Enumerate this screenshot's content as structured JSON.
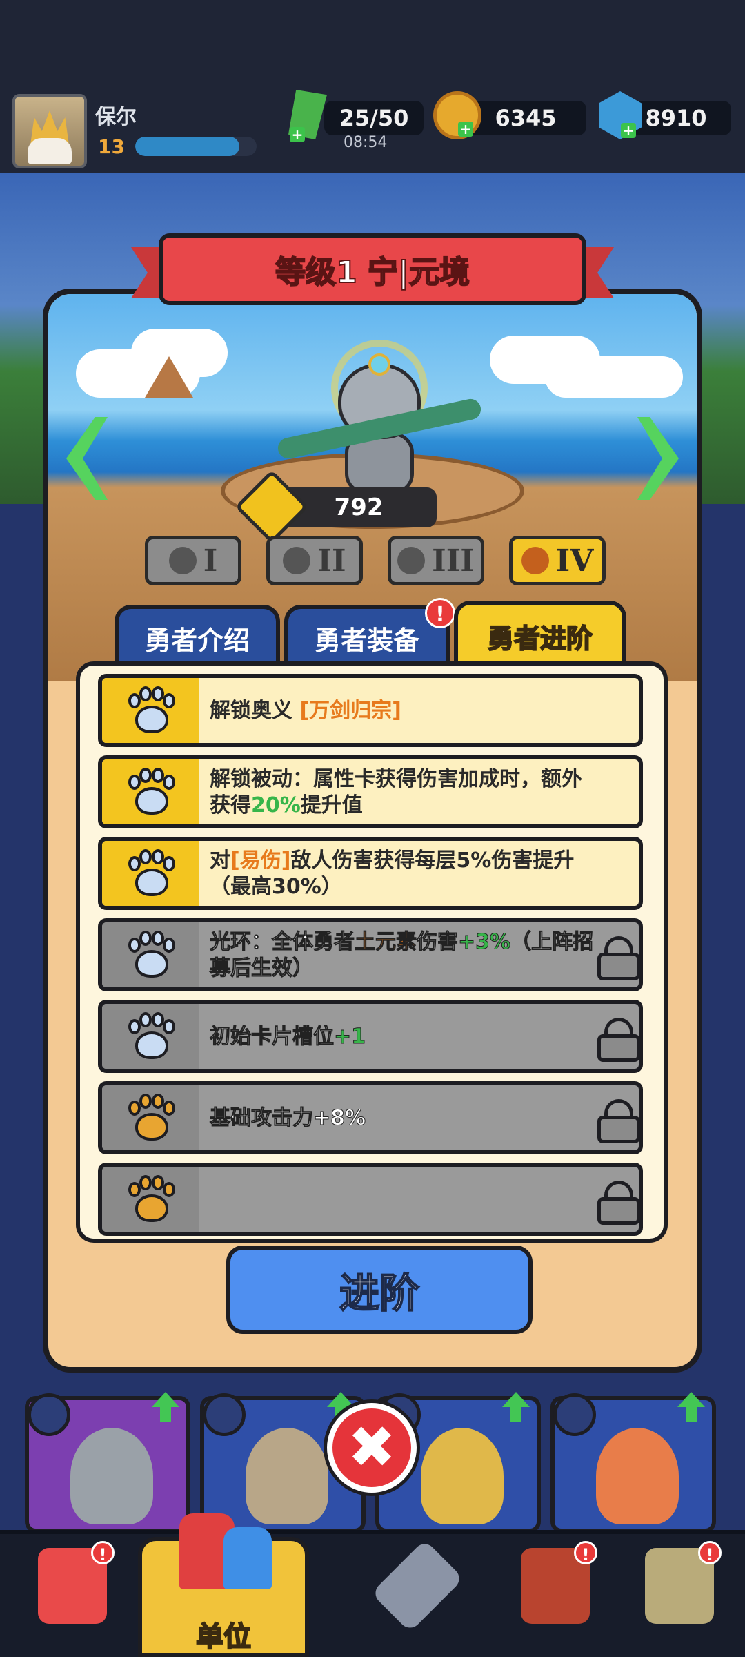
{
  "player": {
    "name": "保尔",
    "level": "13",
    "xp_fraction": 0.86
  },
  "resources": {
    "energy": "25/50",
    "energy_timer": "08:54",
    "gold": "6345",
    "gems": "8910"
  },
  "dialog": {
    "title": "等级1 宁|元境",
    "power": "792",
    "stars": [
      "I",
      "II",
      "III",
      "IV"
    ],
    "active_star_index": 3,
    "tabs": [
      {
        "label": "勇者介绍",
        "active": false
      },
      {
        "label": "勇者装备",
        "active": false,
        "badge": "!"
      },
      {
        "label": "勇者进阶",
        "active": true
      }
    ],
    "advance_button": "进阶",
    "perks": [
      {
        "parts": [
          {
            "t": "解锁奥义 "
          },
          {
            "t": "[万剑归宗]",
            "c": "orange"
          }
        ],
        "locked": false,
        "paw": "blue"
      },
      {
        "parts": [
          {
            "t": "解锁被动：属性卡获得伤害加成时，额外获得"
          },
          {
            "t": "20%",
            "c": "green"
          },
          {
            "t": "提升值"
          }
        ],
        "locked": false,
        "paw": "blue"
      },
      {
        "parts": [
          {
            "t": "对"
          },
          {
            "t": "[易伤]",
            "c": "orange"
          },
          {
            "t": "敌人伤害获得每层5%伤害提升（最高30%）"
          }
        ],
        "locked": false,
        "paw": "blue"
      },
      {
        "parts": [
          {
            "t": "光环：全体勇者"
          },
          {
            "t": "土元素",
            "c": "orange"
          },
          {
            "t": "伤害"
          },
          {
            "t": "+3%",
            "c": "green"
          },
          {
            "t": "（上阵招募后生效）"
          }
        ],
        "locked": true,
        "paw": "blue"
      },
      {
        "parts": [
          {
            "t": "初始卡片槽位"
          },
          {
            "t": "+1",
            "c": "green"
          }
        ],
        "locked": true,
        "paw": "blue"
      },
      {
        "parts": [
          {
            "t": "基础攻击力+8%"
          }
        ],
        "locked": true,
        "paw": "gold"
      },
      {
        "parts": [
          {
            "t": ""
          }
        ],
        "locked": true,
        "paw": "gold"
      }
    ]
  },
  "bottom_nav": {
    "items": [
      {
        "name": "home",
        "badge": "!"
      },
      {
        "name": "units",
        "label": "单位",
        "active": true
      },
      {
        "name": "battle"
      },
      {
        "name": "ship",
        "badge": "!"
      },
      {
        "name": "map",
        "badge": "!"
      }
    ]
  },
  "colors": {
    "accent_blue": "#4f8ff0",
    "tab_active": "#f5cc2a",
    "highlight_orange": "#e77a1c",
    "highlight_green": "#37b54a",
    "badge_red": "#e93a3a"
  }
}
